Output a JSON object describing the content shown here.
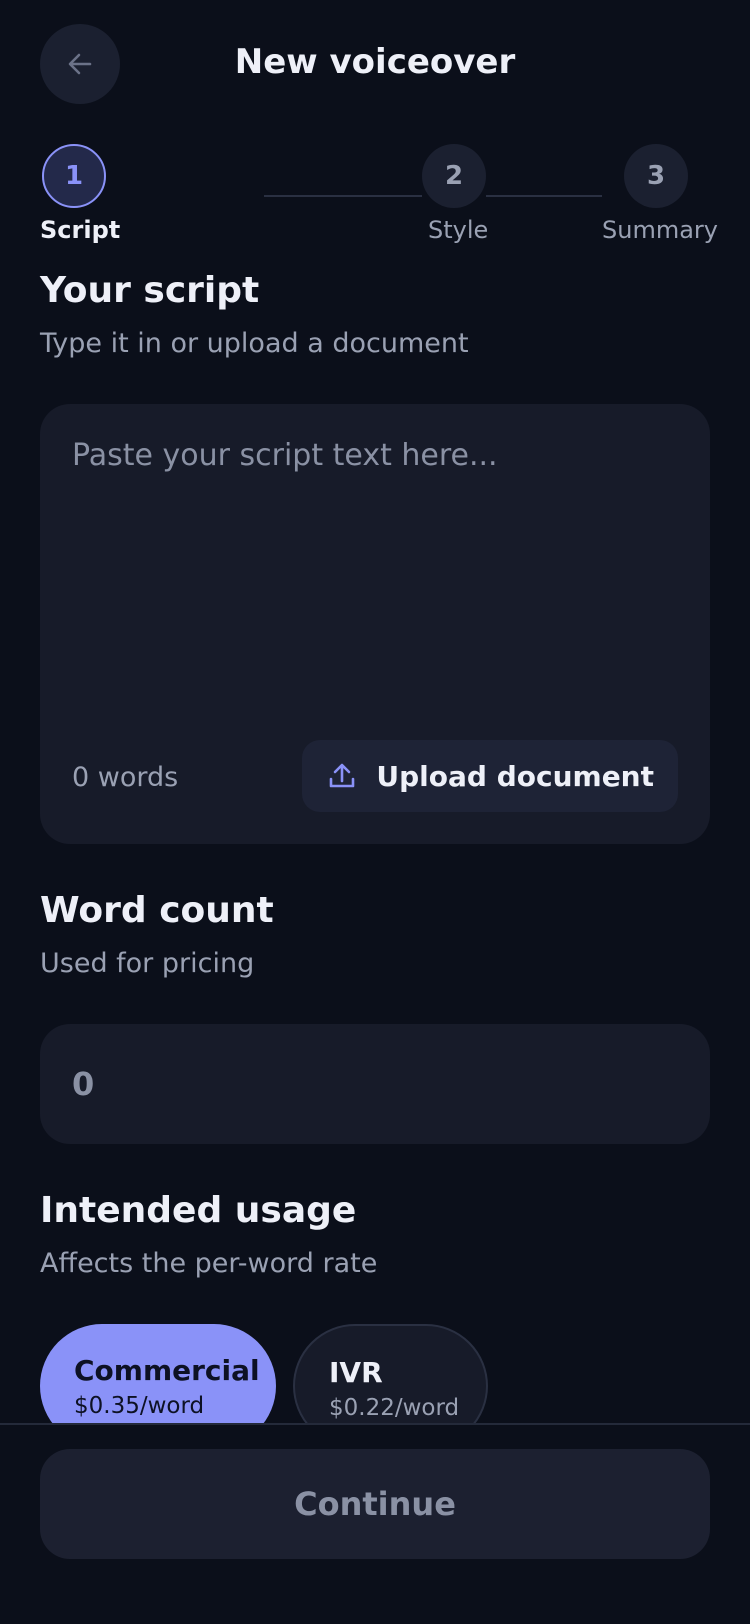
{
  "header": {
    "title": "New voiceover",
    "back_icon": "arrow-left-icon"
  },
  "stepper": {
    "steps": [
      {
        "number": "1",
        "label": "Script",
        "state": "active"
      },
      {
        "number": "2",
        "label": "Style",
        "state": "upcoming"
      },
      {
        "number": "3",
        "label": "Summary",
        "state": "upcoming"
      }
    ]
  },
  "script_section": {
    "title": "Your script",
    "subtitle": "Type it in or upload a document",
    "placeholder": "Paste your script text here...",
    "value": "",
    "word_count": "0 words",
    "upload_label": "Upload document",
    "upload_icon": "upload-icon"
  },
  "word_count_section": {
    "title": "Word count",
    "subtitle": "Used for pricing",
    "value": "0"
  },
  "usage_section": {
    "title": "Intended usage",
    "subtitle": "Affects the per-word rate",
    "options": [
      {
        "name": "Commercial",
        "rate": "$0.35/word",
        "selected": true
      },
      {
        "name": "IVR",
        "rate": "$0.22/word",
        "selected": false
      }
    ]
  },
  "footer": {
    "continue_label": "Continue",
    "continue_enabled": false
  },
  "colors": {
    "background": "#0b0f1a",
    "card": "#171b29",
    "accent": "#8a92f8",
    "muted_text": "#9aa1b3"
  }
}
